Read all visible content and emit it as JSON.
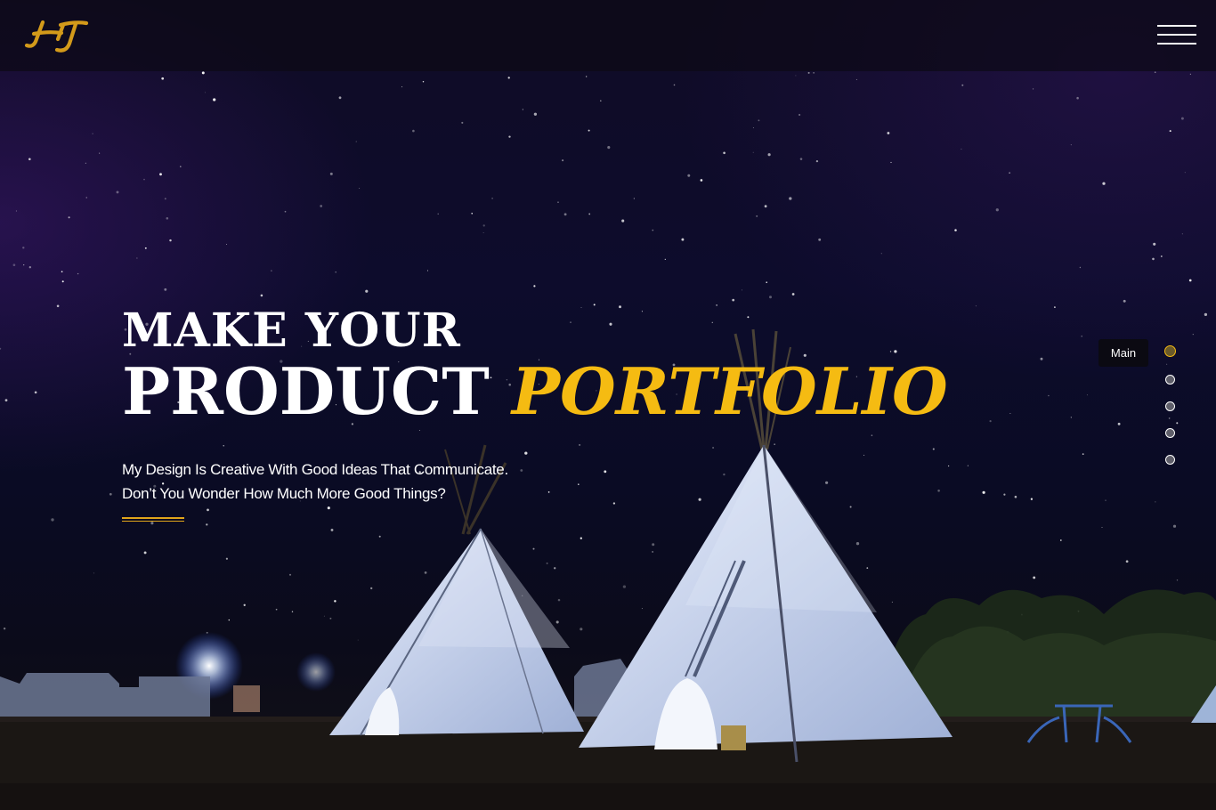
{
  "header": {
    "logo_text": "HJ",
    "menu_icon": "hamburger-menu-icon"
  },
  "hero": {
    "headline_line1": "MAKE YOUR",
    "headline_line2_plain": "PRODUCT",
    "headline_line2_accent": "PORTFOLIO",
    "description_line1": "My Design Is Creative With Good Ideas That Communicate.",
    "description_line2": "Don’t You Wonder How Much More Good Things?"
  },
  "section_nav": {
    "active_label": "Main",
    "dot_count": 5,
    "active_index": 0
  },
  "colors": {
    "accent": "#f5bb12",
    "text": "#ffffff",
    "background": "#0b0a1e"
  }
}
